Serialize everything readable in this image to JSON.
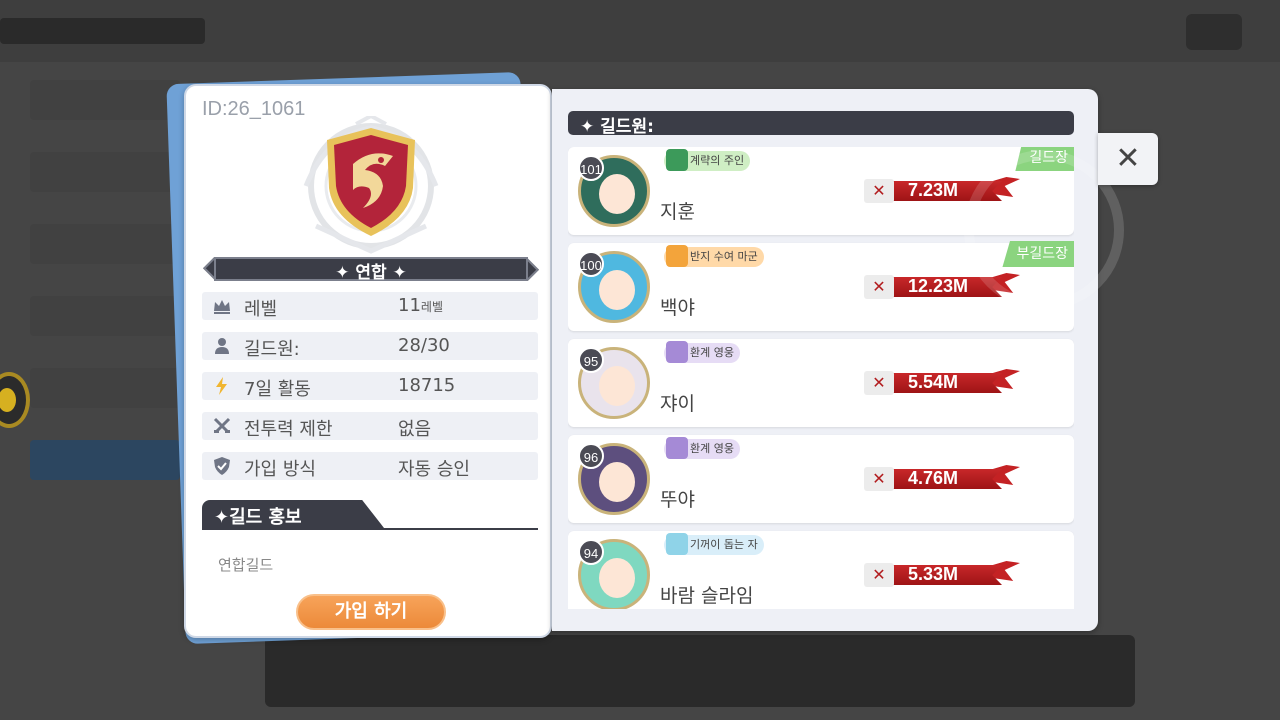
{
  "guild": {
    "id": "ID:26_1061",
    "name": "연합",
    "info": [
      {
        "icon": "crown-icon",
        "key": "레벨",
        "value": "11",
        "unit": "레벨"
      },
      {
        "icon": "person-icon",
        "key": "길드원:",
        "value": "28/30",
        "unit": ""
      },
      {
        "icon": "lightning-icon",
        "key": "7일 활동",
        "value": "18715",
        "unit": ""
      },
      {
        "icon": "crossed-swords-icon",
        "key": "전투력 제한",
        "value": "없음",
        "unit": ""
      },
      {
        "icon": "shield-check-icon",
        "key": "가입 방식",
        "value": "자동 승인",
        "unit": ""
      }
    ],
    "promo_label": "길드 홍보",
    "promo_text": "연합길드",
    "join_label": "가입 하기"
  },
  "members_header": "길드원:",
  "members": [
    {
      "level": "101",
      "title": "계략의 주인",
      "name": "지훈",
      "power": "7.23M",
      "role": "길드장",
      "title_color": "#cfeec4",
      "avatar_color": "#2f6d5c"
    },
    {
      "level": "100",
      "title": "반지 수여 마군",
      "name": "백야",
      "power": "12.23M",
      "role": "부길드장",
      "title_color": "#ffd9a8",
      "avatar_color": "#4fb8e0"
    },
    {
      "level": "95",
      "title": "환계 영웅",
      "name": "쟈이",
      "power": "5.54M",
      "role": "",
      "title_color": "#e6dcf5",
      "avatar_color": "#e9e3ec"
    },
    {
      "level": "96",
      "title": "환계 영웅",
      "name": "뚜야",
      "power": "4.76M",
      "role": "",
      "title_color": "#e6dcf5",
      "avatar_color": "#5d4f7e"
    },
    {
      "level": "94",
      "title": "기꺼이 돕는 자",
      "name": "바람 슬라임",
      "power": "5.33M",
      "role": "",
      "title_color": "#d9eef9",
      "avatar_color": "#7fd8c0"
    }
  ],
  "colors": {
    "accent": "#ec8a3a",
    "banner": "#3b3d47",
    "power_red": "#b21d1f",
    "role_green": "#8bd47f"
  }
}
